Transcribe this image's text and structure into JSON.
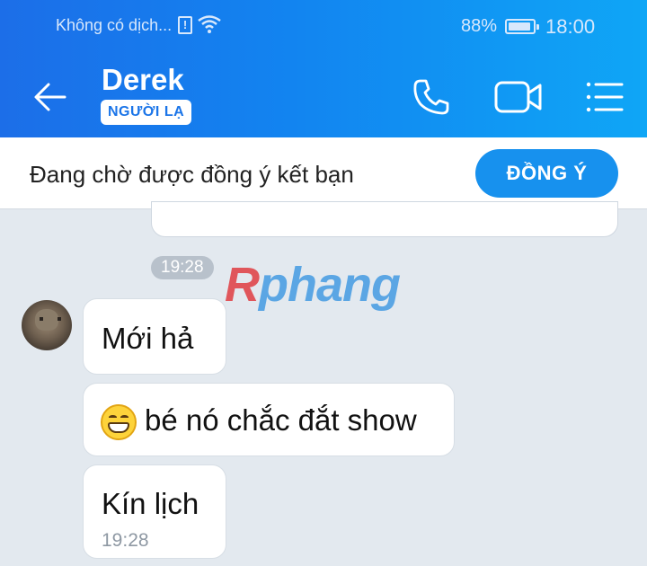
{
  "status_bar": {
    "carrier": "Không có dịch...",
    "sim_alert": "!",
    "battery": "88%",
    "time": "18:00"
  },
  "header": {
    "contact_name": "Derek",
    "badge": "NGƯỜI LẠ",
    "icons": [
      "back-arrow-icon",
      "phone-icon",
      "video-camera-icon",
      "menu-list-icon"
    ]
  },
  "friend_request": {
    "text": "Đang chờ được đồng ý kết bạn",
    "accept_label": "ĐỒNG Ý"
  },
  "chat": {
    "timestamp": "19:28",
    "watermark": {
      "first": "R",
      "rest": "phang"
    },
    "messages": [
      {
        "text": "Mới hả"
      },
      {
        "emoji": "grinning-face-icon",
        "text": "bé nó chắc đắt show"
      },
      {
        "text": "Kín lịch",
        "time": "19:28"
      }
    ]
  },
  "colors": {
    "header_start": "#1c6ee8",
    "header_end": "#0fa6f6",
    "accent": "#1791ee",
    "chat_bg": "#e3e9ef"
  }
}
